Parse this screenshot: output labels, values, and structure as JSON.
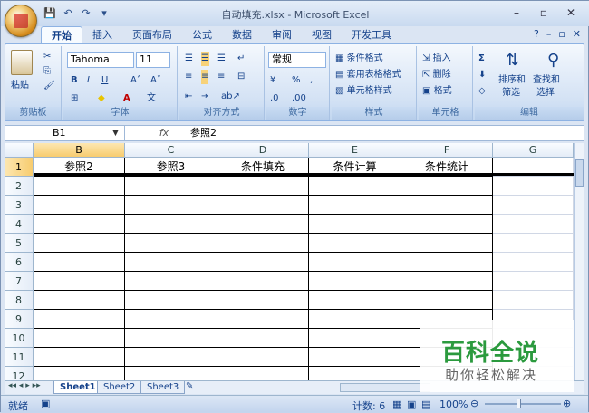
{
  "window": {
    "title": "自动填充.xlsx - Microsoft Excel"
  },
  "qat": {
    "save": "💾",
    "undo": "↶",
    "redo": "↷",
    "more": "▾"
  },
  "ribbon_tabs": [
    "开始",
    "插入",
    "页面布局",
    "公式",
    "数据",
    "审阅",
    "视图",
    "开发工具"
  ],
  "ribbon": {
    "paste_label": "粘贴",
    "font_name": "Tahoma",
    "font_size": "11",
    "number_format": "常规",
    "cond_format": "条件格式",
    "table_format": "套用表格格式",
    "cell_style": "单元格样式",
    "insert": "插入",
    "delete": "删除",
    "format": "格式",
    "sort_filter": "排序和\n筛选",
    "find_select": "查找和\n选择",
    "sort_label": "排序和",
    "sort_label2": "筛选",
    "find_label": "查找和",
    "find_label2": "选择",
    "groups": [
      "剪贴板",
      "字体",
      "对齐方式",
      "数字",
      "样式",
      "单元格",
      "编辑"
    ]
  },
  "formula_bar": {
    "name_box": "B1",
    "fx": "fx",
    "value": "参照2"
  },
  "columns": [
    "B",
    "C",
    "D",
    "E",
    "F",
    "G"
  ],
  "rows": [
    "1",
    "2",
    "3",
    "4",
    "5",
    "6",
    "7",
    "8",
    "9",
    "10",
    "11",
    "12"
  ],
  "header_row": [
    "参照2",
    "参照3",
    "条件填充",
    "条件计算",
    "条件统计",
    ""
  ],
  "sheets": [
    "Sheet1",
    "Sheet2",
    "Sheet3"
  ],
  "status": {
    "ready": "就绪",
    "count": "计数: 6",
    "zoom": "100%"
  },
  "watermark": {
    "line1": "百科全说",
    "line2": "助你轻松解决"
  }
}
